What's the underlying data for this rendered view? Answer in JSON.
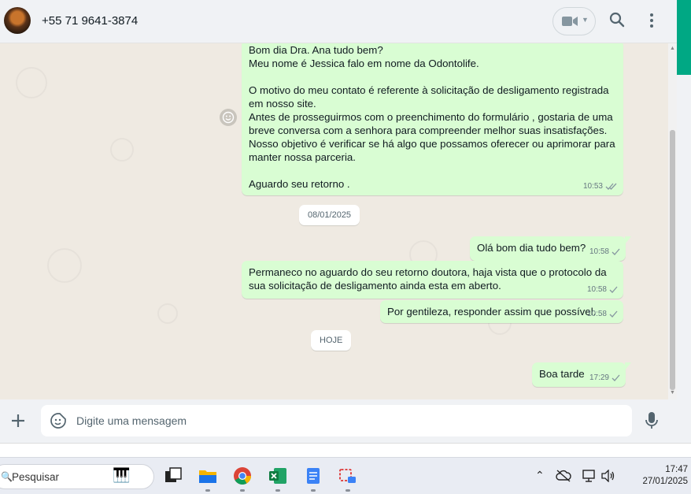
{
  "header": {
    "contact_name": "+55 71 9641-3874",
    "icons": [
      "avatar",
      "video-call-icon",
      "search-icon",
      "more-options-icon"
    ]
  },
  "messages": [
    {
      "text": "Bom dia Dra. Ana tudo bem?\nMeu nome é Jessica falo em nome da Odontolife.\n\nO motivo do meu contato é referente à solicitação de desligamento registrada em nosso site.\nAntes de prosseguirmos com o preenchimento do formulário , gostaria de uma breve conversa com a senhora para compreender melhor suas insatisfações. Nosso objetivo é verificar se há algo que possamos oferecer ou aprimorar para manter nossa parceria.\n\nAguardo seu retorno .",
      "time": "10:53",
      "status": "read"
    },
    {
      "text": "Olá bom dia tudo bem?",
      "time": "10:58",
      "status": "sent"
    },
    {
      "text": "Permaneco no aguardo do seu retorno doutora, haja vista que o protocolo da sua solicitação de desligamento ainda esta em aberto.",
      "time": "10:58",
      "status": "sent"
    },
    {
      "text": "Por gentileza, responder assim que possível.",
      "time": "10:58",
      "status": "sent"
    },
    {
      "text": "Boa tarde",
      "time": "17:29",
      "status": "sent"
    }
  ],
  "dates": {
    "day1": "08/01/2025",
    "today": "HOJE"
  },
  "composer": {
    "placeholder": "Digite uma mensagem"
  },
  "taskbar": {
    "search_label": "Pesquisar",
    "time": "17:47",
    "date": "27/01/2025",
    "apps": [
      "task-view",
      "file-explorer",
      "chrome",
      "excel",
      "notepad",
      "snipping-tool"
    ]
  },
  "colors": {
    "outgoing_bubble": "#d9fdd3",
    "chat_background": "#efeae2",
    "accent": "#00a884",
    "read_ticks": "#53bdeb"
  }
}
